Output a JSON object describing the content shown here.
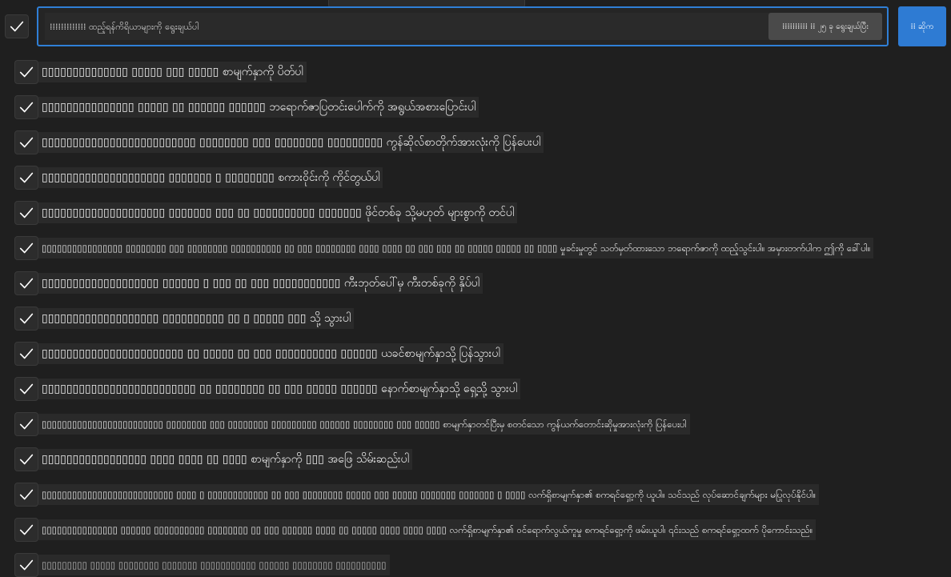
{
  "header": {
    "search_placeholder": "⁞⁞⁞⁞⁞⁞⁞⁞⁞⁞⁞⁞⁞ ထည့်ရန်ကိရိယာများကို ရွေးချယ်ပါ",
    "filter_chip": "⁞⁞⁞⁞⁞⁞⁞⁞⁞⁞ ⁞⁞ ၂၅ ခု ရွေးချယ်ပြီး",
    "send_label": "⁞⁞ ဆိုက"
  },
  "items": [
    {
      "label": "▯▯▯▯▯▯▯▯▯▯▯▯▯▯ ▯▯▯▯▯ ▯▯▯ ▯▯▯▯▯ စာမျက်နှာကို ပိတ်ပါ",
      "checked": true
    },
    {
      "label": "▯▯▯▯▯▯▯▯▯▯▯▯▯▯▯ ▯▯▯▯▯ ▯▯ ▯▯▯▯▯▯ ▯▯▯▯▯▯ ဘရောက်ဇာပြတင်းပေါက်ကို အရွယ်အစားပြောင်းပါ",
      "checked": true
    },
    {
      "label": "▯▯▯▯▯▯▯▯▯▯▯▯▯▯▯▯▯▯▯▯▯▯▯▯▯ ▯▯▯▯▯▯▯▯ ▯▯▯ ▯▯▯▯▯▯▯▯ ▯▯▯▯▯▯▯▯▯ ကွန်ဆိုလ်စာတိုက်အားလုံးကို ပြန်ပေးပါ",
      "checked": true
    },
    {
      "label": "▯▯▯▯▯▯▯▯▯▯▯▯▯▯▯▯▯▯▯▯ ▯▯▯▯▯▯▯ ▯ ▯▯▯▯▯▯▯▯ စကားဝိုင်းကို ကိုင်တွယ်ပါ",
      "checked": true
    },
    {
      "label": "▯▯▯▯▯▯▯▯▯▯▯▯▯▯▯▯▯▯▯▯ ▯▯▯▯▯▯▯ ▯▯▯ ▯▯ ▯▯▯▯▯▯▯▯▯▯ ▯▯▯▯▯▯▯ ဖိုင်တစ်ခု သို့မဟုတ် များစွာကို တင်ပါ",
      "checked": true
    },
    {
      "label": "▯▯▯▯▯▯▯▯▯▯▯▯▯▯▯▯ ▯▯▯▯▯▯▯▯ ▯▯▯ ▯▯▯▯▯▯▯▯ ▯▯▯▯▯▯▯▯▯▯ ▯▯ ▯▯▯ ▯▯▯▯▯▯▯▯ ▯▯▯▯ ▯▯▯▯ ▯▯ ▯▯▯ ▯▯▯ ▯▯ ▯▯▯▯▯ ▯▯▯▯▯ ▯▯ ▯▯▯▯ မှုခင်းမှုတွင် သတ်မှတ်ထားသော ဘရောက်ဇာကို ထည့်သွင်းပါ။ အမှားတက်ပါက ဤကို ခေါ်ပါ။",
      "checked": true,
      "small": true
    },
    {
      "label": "▯▯▯▯▯▯▯▯▯▯▯▯▯▯▯▯▯▯▯ ▯▯▯▯▯▯ ▯ ▯▯▯ ▯▯ ▯▯▯ ▯▯▯▯▯▯▯▯▯▯▯ ကီးဘုတ်ပေါ်မှ ကီးတစ်ခုကို နှိပ်ပါ",
      "checked": true
    },
    {
      "label": "▯▯▯▯▯▯▯▯▯▯▯▯▯▯▯▯▯▯▯ ▯▯▯▯▯▯▯▯▯▯ ▯▯ ▯ ▯▯▯▯▯ ▯▯▯ သို့ သွားပါ",
      "checked": true
    },
    {
      "label": "▯▯▯▯▯▯▯▯▯▯▯▯▯▯▯▯▯▯▯▯▯▯▯ ▯▯ ▯▯▯▯▯ ▯▯ ▯▯▯ ▯▯▯▯▯▯▯▯▯▯ ▯▯▯▯▯▯ ယခင်စာမျက်နှာသို့ ပြန်သွားပါ",
      "checked": true
    },
    {
      "label": "▯▯▯▯▯▯▯▯▯▯▯▯▯▯▯▯▯▯▯▯▯▯▯▯▯ ▯▯ ▯▯▯▯▯▯▯▯ ▯▯ ▯▯▯ ▯▯▯▯▯ ▯▯▯▯▯▯ နောက်စာမျက်နှာသို့ ရှေ့သို့ သွားပါ",
      "checked": true
    },
    {
      "label": "▯▯▯▯▯▯▯▯▯▯▯▯▯▯▯▯▯▯▯▯▯▯▯▯ ▯▯▯▯▯▯▯▯ ▯▯▯ ▯▯▯▯▯▯▯▯ ▯▯▯▯▯▯▯▯▯ ▯▯▯▯▯▯ ▯▯▯▯▯▯▯▯ ▯▯▯ ▯▯▯▯▯ စာမျက်နှာတင်ပြီးမှ စတင်သော ကွန်ယက်တောင်းဆိုမှုအားလုံးကို ပြန်ပေးပါ",
      "checked": true,
      "small": true
    },
    {
      "label": "▯▯▯▯▯▯▯▯▯▯▯▯▯▯▯▯▯ ▯▯▯▯ ▯▯▯▯ ▯▯ ▯▯▯▯ စာမျက်နှာကို ▯▯▯ အဖြေ သိမ်းဆည်းပါ",
      "checked": true
    },
    {
      "label": "▯▯▯▯▯▯▯▯▯▯▯▯▯▯▯▯▯▯▯▯▯▯▯▯▯▯ ▯▯▯▯ ▯ ▯▯▯▯▯▯▯▯▯▯▯▯ ▯▯ ▯▯▯ ▯▯▯▯▯▯▯▯ ▯▯▯▯▯ ▯▯▯ ▯▯▯▯▯ ▯▯▯▯▯▯▯ ▯▯▯▯▯▯▯ ▯ ▯▯▯▯ လက်ရှိစာမျက်နှာ၏ စကရင်ရှော့ကို ယူပါ။ သင်သည် လုပ်ဆောင်ချက်များ မပြုလုပ်နိုင်ပါ။",
      "checked": true,
      "small": true
    },
    {
      "label": "▯▯▯▯▯▯▯▯▯▯▯▯▯▯▯ ▯▯▯▯▯▯ ▯▯▯▯▯▯▯▯▯▯ ▯▯▯▯▯▯▯▯ ▯▯ ▯▯▯ ▯▯▯▯▯▯ ▯▯▯▯ ▯▯ ▯▯▯▯▯ ▯▯▯▯ ▯▯▯▯ ▯▯▯▯ လက်ရှိစာမျက်နှာ၏ ဝင်ရောက်လွယ်ကူမှု စကရင်ရှော့ကို ဖမ်းယူပါ၊ ၎င်းသည် စကရင်ရှော့ထက် ပိုကောင်းသည်။",
      "checked": true,
      "small": true
    },
    {
      "label": "▯▯▯▯▯▯▯▯▯ ▯▯▯▯▯ ▯▯▯▯▯▯▯▯ ▯▯▯▯▯▯▯ ▯▯▯▯▯▯▯▯▯▯▯ ▯▯▯▯▯▯ ▯▯▯▯▯▯▯▯ ▯▯▯▯▯▯▯▯▯▯",
      "checked": true,
      "small": true,
      "partial": true
    }
  ],
  "colors": {
    "accent": "#2e7bd3",
    "background": "#1f1f1f",
    "check": "#ffffff"
  },
  "icons": {
    "check": "check-icon"
  }
}
